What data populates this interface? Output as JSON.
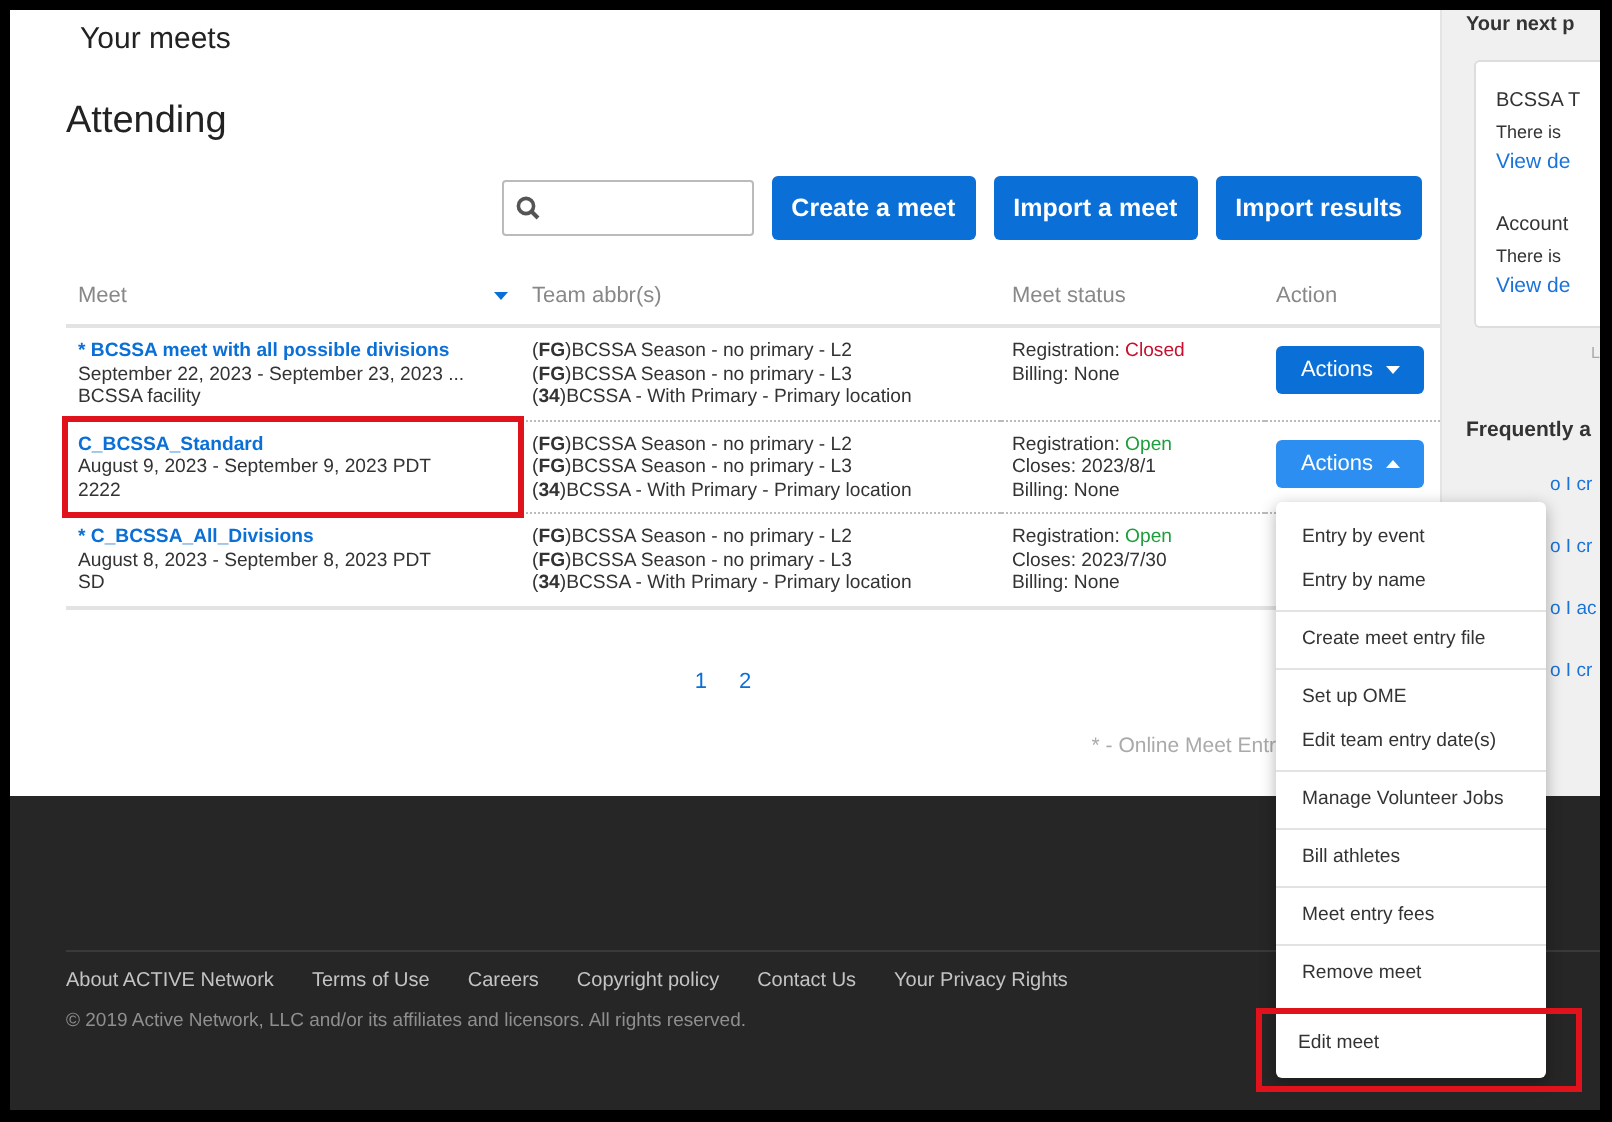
{
  "page_title": "Your meets",
  "section_title": "Attending",
  "toolbar_buttons": [
    "Create a meet",
    "Import a meet",
    "Import results"
  ],
  "table": {
    "columns": [
      {
        "label": "Meet",
        "sorted": true
      },
      {
        "label": "Team abbr(s)",
        "sorted": false
      },
      {
        "label": "Meet status",
        "sorted": false
      },
      {
        "label": "Action",
        "sorted": false
      }
    ],
    "rows": [
      {
        "meet": {
          "name": "* BCSSA meet with all possible divisions",
          "lines": [
            "September 22, 2023 - September 23, 2023 ...",
            "BCSSA facility"
          ],
          "highlighted": false
        },
        "teams": [
          "(**FG**)BCSSA Season - no primary - L2",
          "(**FG**)BCSSA Season - no primary - L3",
          "(**34**)BCSSA - With Primary - Primary location"
        ],
        "status": {
          "registration_label": "Registration:",
          "registration_value": "Closed",
          "color": "#c8102e",
          "lines": [
            "Billing: None"
          ]
        },
        "action": {
          "label": "Actions",
          "expanded": false
        }
      },
      {
        "meet": {
          "name": "C_BCSSA_Standard",
          "lines": [
            "August 9, 2023 - September 9, 2023 PDT",
            "2222"
          ],
          "highlighted": true
        },
        "teams": [
          "(**FG**)BCSSA Season - no primary - L2",
          "(**FG**)BCSSA Season - no primary - L3",
          "(**34**)BCSSA - With Primary - Primary location"
        ],
        "status": {
          "registration_label": "Registration:",
          "registration_value": "Open",
          "color": "#1e9e3c",
          "lines": [
            "Closes: 2023/8/1",
            "Billing: None"
          ]
        },
        "action": {
          "label": "Actions",
          "expanded": true
        }
      },
      {
        "meet": {
          "name": "* C_BCSSA_All_Divisions",
          "lines": [
            "August 8, 2023 - September 8, 2023 PDT",
            "SD"
          ],
          "highlighted": false
        },
        "teams": [
          "(**FG**)BCSSA Season - no primary - L2",
          "(**FG**)BCSSA Season - no primary - L3",
          "(**34**)BCSSA - With Primary - Primary location"
        ],
        "status": {
          "registration_label": "Registration:",
          "registration_value": "Open",
          "color": "#1e9e3c",
          "lines": [
            "Closes: 2023/7/30",
            "Billing: None"
          ]
        }
      }
    ]
  },
  "pagination": [
    "1",
    "2"
  ],
  "footnote": "* - Online Meet Entr",
  "actions_menu": [
    [
      {
        "label": "Entry by event",
        "highlighted": false
      },
      {
        "label": "Entry by name",
        "highlighted": false
      }
    ],
    [
      {
        "label": "Create meet entry file",
        "highlighted": false
      }
    ],
    [
      {
        "label": "Set up OME",
        "highlighted": false
      },
      {
        "label": "Edit team entry date(s)",
        "highlighted": false
      }
    ],
    [
      {
        "label": "Manage Volunteer Jobs",
        "highlighted": false
      }
    ],
    [
      {
        "label": "Bill athletes",
        "highlighted": false
      }
    ],
    [
      {
        "label": "Meet entry fees",
        "highlighted": false
      }
    ],
    [
      {
        "label": "Remove meet",
        "highlighted": false
      },
      {
        "label": "Edit meet",
        "highlighted": true
      }
    ]
  ],
  "sidebar": {
    "title": "Your next p",
    "card": [
      {
        "title": "BCSSA T",
        "text": "There is",
        "link": "View de"
      },
      {
        "title": "Account",
        "text": "There is",
        "link": "View de"
      }
    ],
    "more": "L",
    "faq_title": "Frequently a",
    "faq_links": [
      "o I cr",
      "o I cr",
      "o I ac",
      "o I cr"
    ]
  },
  "footer": {
    "links": [
      "About ACTIVE Network",
      "Terms of Use",
      "Careers",
      "Copyright policy",
      "Contact Us",
      "Your Privacy Rights"
    ],
    "copyright": "© 2019 Active Network, LLC and/or its affiliates and licensors. All rights reserved."
  }
}
